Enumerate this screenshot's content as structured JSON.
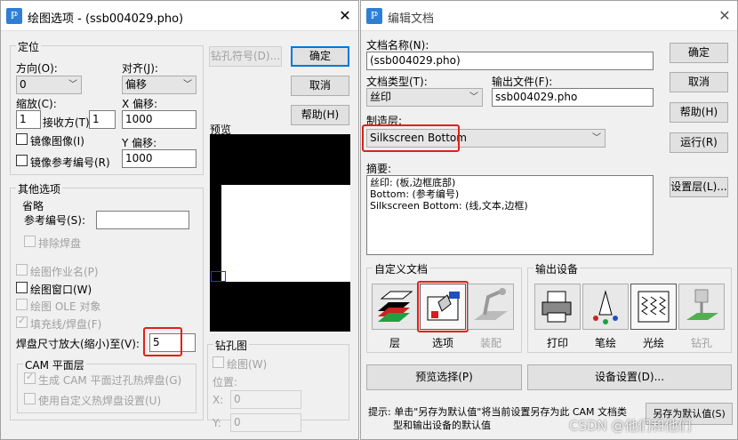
{
  "left": {
    "title": "绘图选项 - (ssb004029.pho)",
    "locate": {
      "group": "定位",
      "direction_label": "方向(O):",
      "direction_value": "0",
      "align_label": "对齐(J):",
      "align_value": "偏移",
      "scale_label": "缩放(C):",
      "scale_value": "1",
      "shrink_label": "接收方(T)",
      "shrink_value": "1",
      "xoffset_label": "X 偏移:",
      "xoffset_value": "1000",
      "yoffset_label": "Y 偏移:",
      "yoffset_value": "1000",
      "mirror_label": "镜像图像(I)",
      "mirror_ref_label": "镜像参考编号(R)"
    },
    "other": {
      "group": "其他选项",
      "omit_group": "省略",
      "refdes_label": "参考编号(S):",
      "refdes_value": "",
      "exclude_pads": "排除焊盘",
      "plot_job_name": "绘图作业名(P)",
      "plot_window": "绘图窗口(W)",
      "plot_ole": "绘图 OLE 对象",
      "fill_pads": "填充线/焊盘(F)",
      "pad_scale_label": "焊盘尺寸放大(缩小)至(V):",
      "pad_scale_value": "5",
      "cam_group": "CAM 平面层",
      "cam_thermal": "生成 CAM 平面过孔热焊盘(G)",
      "cam_custom": "使用自定义热焊盘设置(U)"
    },
    "buttons": {
      "drill_symbol": "钻孔符号(D)...",
      "ok": "确定",
      "cancel": "取消",
      "help": "帮助(H)"
    },
    "preview_label": "预览",
    "drill": {
      "group": "钻孔图",
      "plot_label": "绘图(W)",
      "position_label": "位置:",
      "x_label": "X:",
      "x_value": "0",
      "y_label": "Y:",
      "y_value": "0"
    }
  },
  "right": {
    "title": "编辑文档",
    "doc_name_label": "文档名称(N):",
    "doc_name_value": "(ssb004029.pho)",
    "doc_type_label": "文档类型(T):",
    "doc_type_value": "丝印",
    "output_file_label": "输出文件(F):",
    "output_file_value": "ssb004029.pho",
    "layer_label": "制造层:",
    "layer_value": "Silkscreen Bottom",
    "summary_label": "摘要:",
    "summary_lines": {
      "l1": "丝印: (板,边框底部)",
      "l2": "Bottom: (参考编号)",
      "l3": "Silkscreen Bottom: (线,文本,边框)"
    },
    "buttons": {
      "ok": "确定",
      "cancel": "取消",
      "help": "帮助(H)",
      "run": "运行(R)",
      "set_layer": "设置层(L)...",
      "preview_select": "预览选择(P)",
      "device_settings": "设备设置(D)...",
      "save_default": "另存为默认值(S)"
    },
    "custom_doc": {
      "group": "自定义文档",
      "layers": "层",
      "options": "选项",
      "assembly": "装配"
    },
    "output_device": {
      "group": "输出设备",
      "print": "打印",
      "pen": "笔绘",
      "photo": "光绘",
      "drill": "钻孔"
    },
    "hint_line1": "提示: 单击\"另存为默认值\"将当前设置另存为此 CAM 文档类",
    "hint_line2": "型和输出设备的默认值"
  },
  "watermark": "CSDN @他们和他们"
}
